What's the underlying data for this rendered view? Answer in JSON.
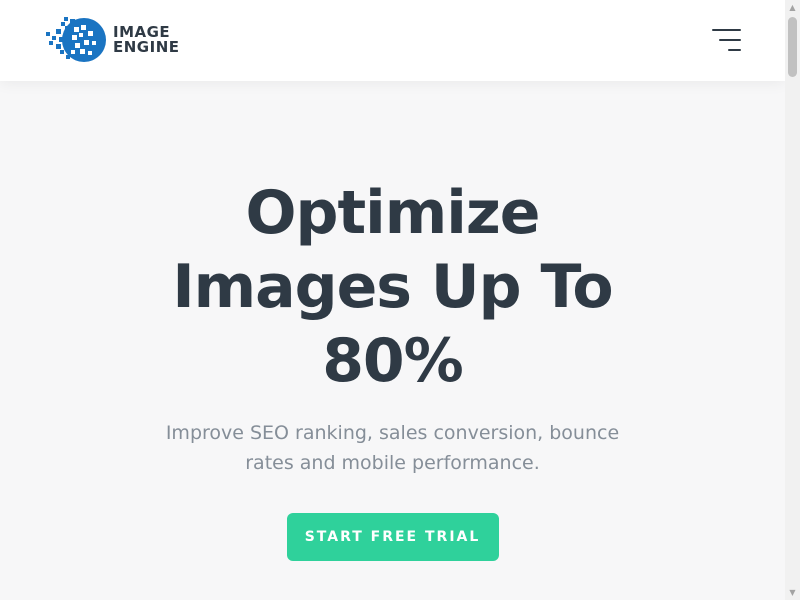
{
  "header": {
    "logo": {
      "line1": "IMAGE",
      "line2": "ENGINE",
      "icon": "image-engine-logo-icon"
    },
    "menu_icon": "hamburger-menu-icon"
  },
  "hero": {
    "title_lines": [
      "Optimize",
      "Images Up To",
      "80%"
    ],
    "subtitle_lines": [
      "Improve SEO ranking, sales conversion, bounce",
      "rates and mobile performance."
    ],
    "cta_label": "START FREE TRIAL"
  },
  "colors": {
    "accent": "#2fd19b",
    "heading": "#2f3a45",
    "subtext": "#858e98",
    "logo_blue": "#1a74c2",
    "background": "#f7f7f8"
  },
  "scrollbar": {
    "up_arrow": "▲",
    "down_arrow": "▼"
  }
}
